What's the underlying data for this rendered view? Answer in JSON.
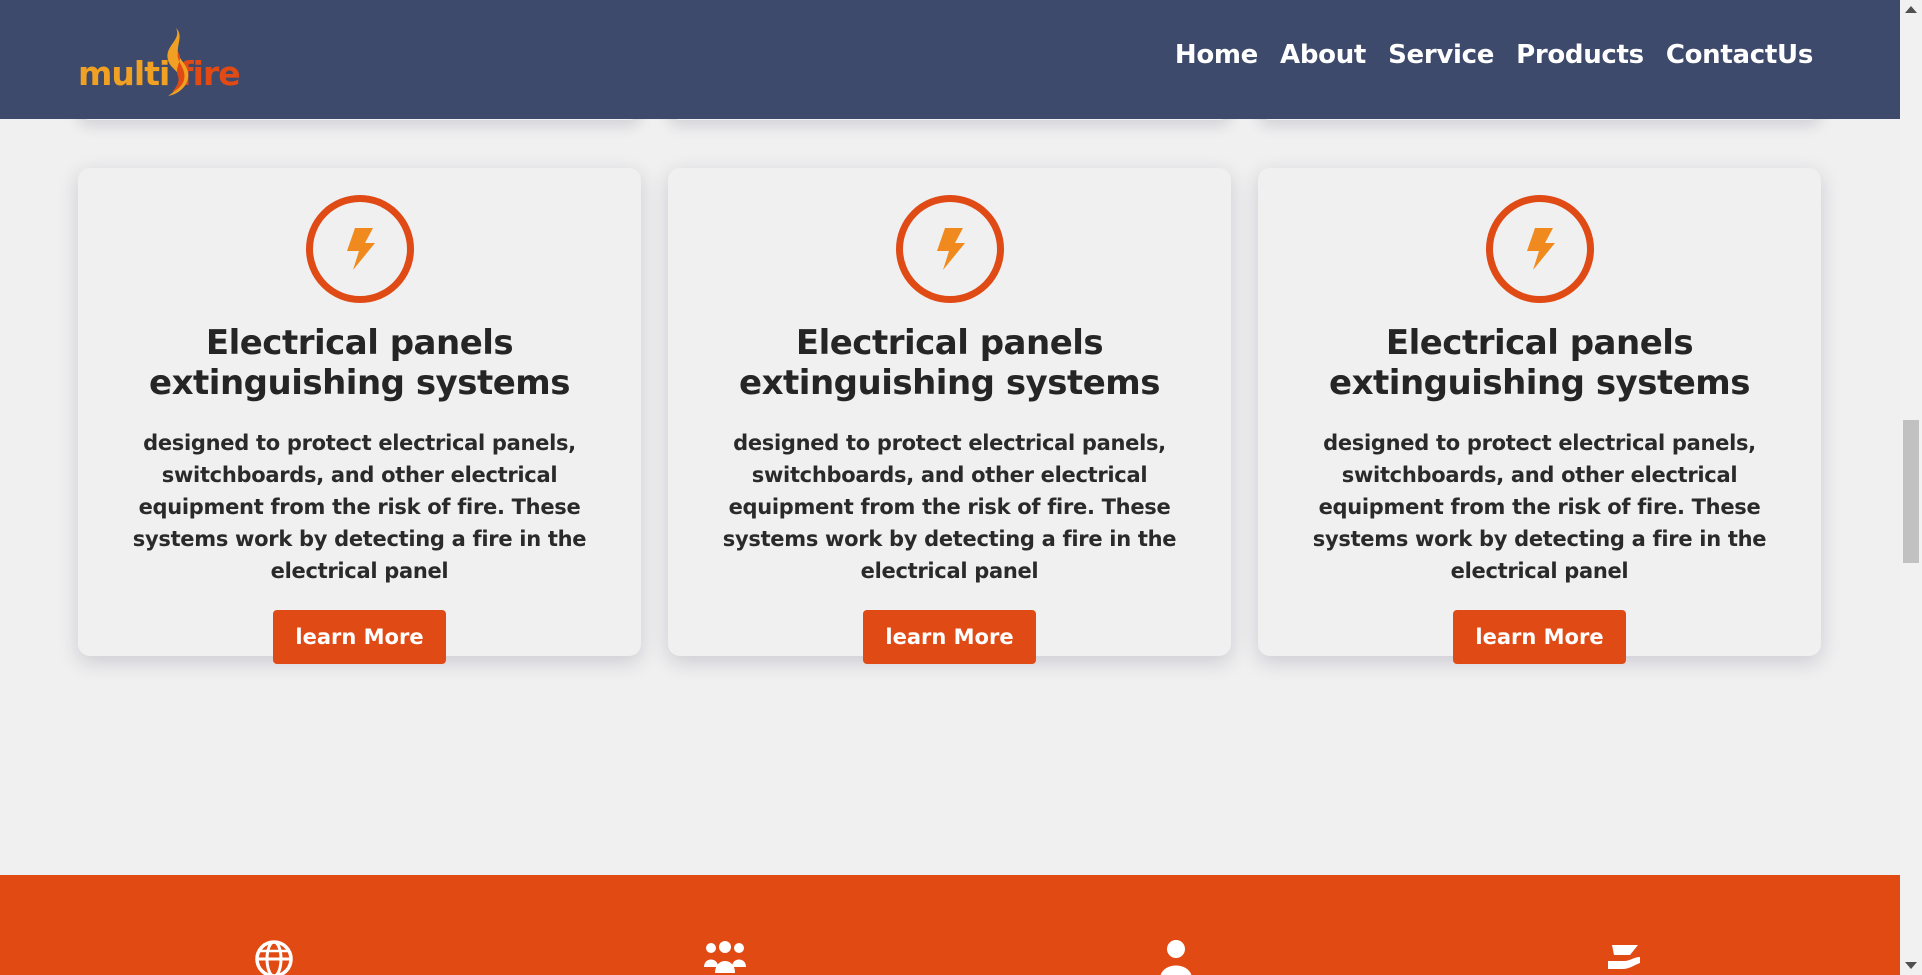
{
  "header": {
    "logo": {
      "part1": "multi",
      "part2": "fire"
    },
    "nav": [
      {
        "label": "Home"
      },
      {
        "label": "About"
      },
      {
        "label": "Service"
      },
      {
        "label": "Products"
      },
      {
        "label": "ContactUs"
      }
    ]
  },
  "services": [
    {
      "icon": "lightning-icon",
      "title": "Electrical panels extinguishing systems",
      "description": "designed to protect electrical panels, switchboards, and other electrical equipment from the risk of fire. These systems work by detecting a fire in the electrical panel",
      "button": "learn More"
    },
    {
      "icon": "lightning-icon",
      "title": "Electrical panels extinguishing systems",
      "description": "designed to protect electrical panels, switchboards, and other electrical equipment from the risk of fire. These systems work by detecting a fire in the electrical panel",
      "button": "learn More"
    },
    {
      "icon": "lightning-icon",
      "title": "Electrical panels extinguishing systems",
      "description": "designed to protect electrical panels, switchboards, and other electrical equipment from the risk of fire. These systems work by detecting a fire in the electrical panel",
      "button": "learn More"
    }
  ],
  "band_icons": [
    "globe-icon",
    "users-group-icon",
    "user-icon",
    "hand-heart-icon"
  ],
  "colors": {
    "header_bg": "#3d4a6b",
    "accent": "#e24a14",
    "logo_orange": "#f0a023"
  }
}
